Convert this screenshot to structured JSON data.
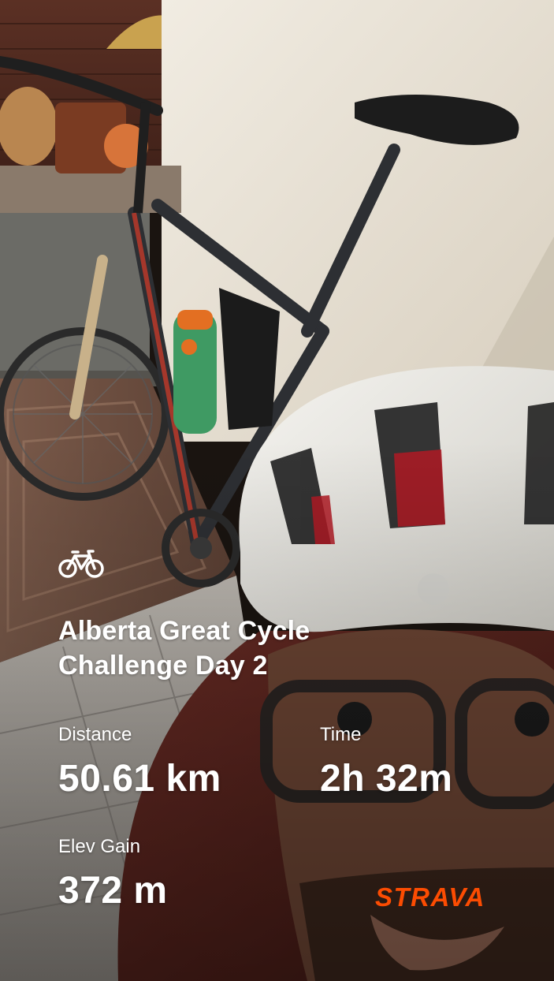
{
  "activity": {
    "icon": "bicycle-icon",
    "title_line1": "Alberta Great Cycle",
    "title_line2": "Challenge Day 2"
  },
  "stats": {
    "distance_label": "Distance",
    "distance_value": "50.61 km",
    "time_label": "Time",
    "time_value": "2h 32m",
    "elev_label": "Elev Gain",
    "elev_value": "372 m"
  },
  "brand": {
    "name": "STRAVA",
    "color": "#fc4c02"
  }
}
